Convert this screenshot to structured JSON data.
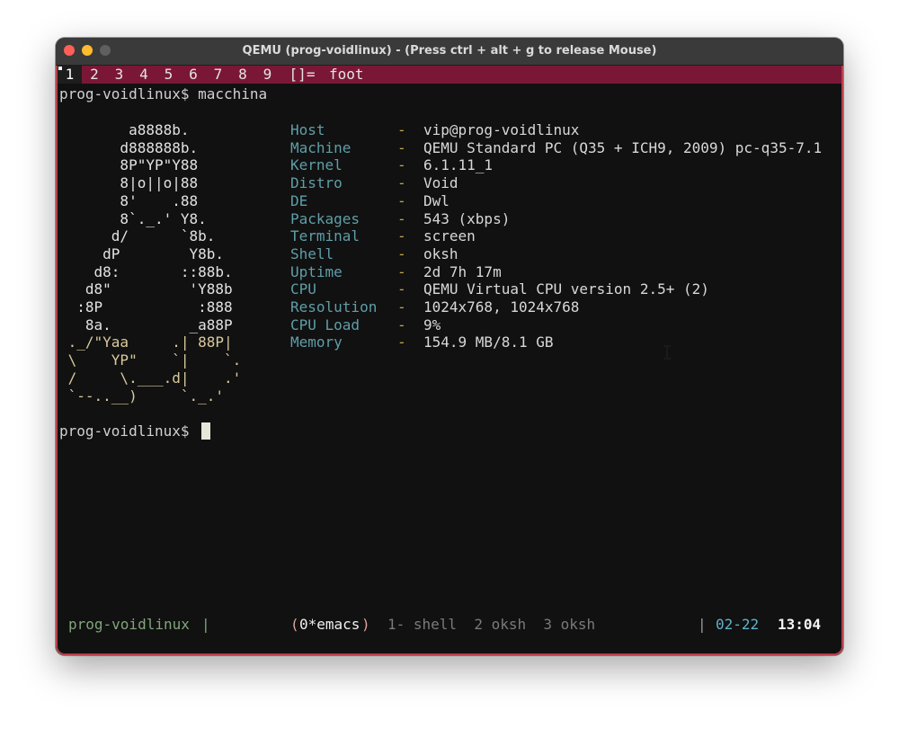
{
  "window": {
    "title": "QEMU (prog-voidlinux) - (Press ctrl + alt + g to release Mouse)"
  },
  "dwl": {
    "tags": [
      "1",
      "2",
      "3",
      "4",
      "5",
      "6",
      "7",
      "8",
      "9"
    ],
    "active_tag": "1",
    "layout": "[]=",
    "window_title": "foot"
  },
  "terminal": {
    "prompt": "prog-voidlinux$ ",
    "command": "macchina",
    "prompt_line_1": "prog-voidlinux$ macchina",
    "prompt_line_2": "prog-voidlinux$ ",
    "ascii_art": [
      "        a8888b.",
      "       d888888b.",
      "       8P\"YP\"Y88",
      "       8|o||o|88",
      "       8'    .88",
      "       8`._.' Y8.",
      "      d/      `8b.",
      "     dP        Y8b.",
      "    d8:       ::88b.",
      "   d8\"         'Y88b",
      "  :8P           :888",
      "   8a.         _a88P",
      " ._/\"Yaa     .| 88P|",
      " \\    YP\"    `|    `.",
      " /     \\.___.d|    .'",
      " `--..__)     `._.'"
    ],
    "info": [
      {
        "key": "Host",
        "value": "vip@prog-voidlinux"
      },
      {
        "key": "Machine",
        "value": "QEMU Standard PC (Q35 + ICH9, 2009) pc-q35-7.1"
      },
      {
        "key": "Kernel",
        "value": "6.1.11_1"
      },
      {
        "key": "Distro",
        "value": "Void"
      },
      {
        "key": "DE",
        "value": "Dwl"
      },
      {
        "key": "Packages",
        "value": "543 (xbps)"
      },
      {
        "key": "Terminal",
        "value": "screen"
      },
      {
        "key": "Shell",
        "value": "oksh"
      },
      {
        "key": "Uptime",
        "value": "2d 7h 17m"
      },
      {
        "key": "CPU",
        "value": "QEMU Virtual CPU version 2.5+ (2)"
      },
      {
        "key": "Resolution",
        "value": "1024x768, 1024x768"
      },
      {
        "key": "CPU Load",
        "value": "9%"
      },
      {
        "key": "Memory",
        "value": "154.9 MB/8.1 GB"
      }
    ],
    "separator": "-"
  },
  "screen_status": {
    "hostname": "prog-voidlinux",
    "divider": "|",
    "window_open": "(",
    "current_window": "0*emacs",
    "window_close": ")",
    "other_windows": "1- shell  2 oksh  3 oksh",
    "divider_right": "|",
    "date": "02-22",
    "time": "13:04"
  },
  "colors": {
    "dwl_bar": "#7b1736",
    "border": "#b7404a",
    "info_key": "#5f9ea8",
    "info_dash": "#c0a84a",
    "status_host": "#7fa67a",
    "status_date": "#5fb3c8"
  }
}
